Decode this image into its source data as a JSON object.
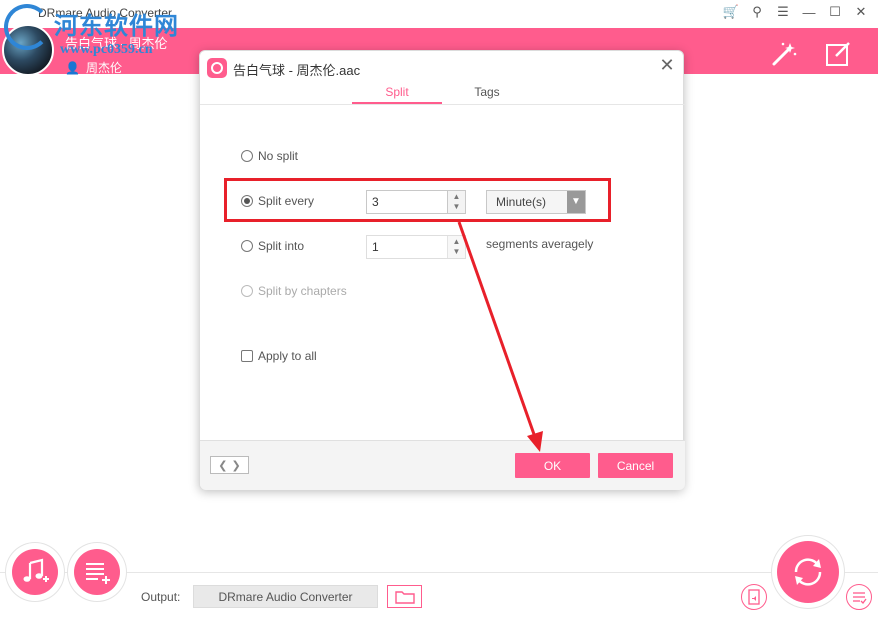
{
  "window": {
    "title": "DRmare Audio Converter",
    "controls": [
      "cart-icon",
      "search-icon",
      "menu-icon",
      "minimize-icon",
      "maximize-icon",
      "close-icon"
    ]
  },
  "watermark": {
    "main": "河东软件网",
    "url": "www.pc0359.cn"
  },
  "header": {
    "song_title": "告白气球 - 周杰伦",
    "artist": "周杰伦",
    "accent_color": "#ff5c8d"
  },
  "dialog": {
    "title": "告白气球 - 周杰伦.aac",
    "tabs": [
      {
        "label": "Split",
        "active": true
      },
      {
        "label": "Tags",
        "active": false
      }
    ],
    "options": {
      "no_split": "No split",
      "split_every": "Split every",
      "split_every_value": "3",
      "split_every_unit": "Minute(s)",
      "split_into": "Split into",
      "split_into_value": "1",
      "segments_hint": "segments averagely",
      "split_by_chapters": "Split by chapters",
      "apply_to_all": "Apply to all"
    },
    "selected_option": "split_every",
    "footer": {
      "ok": "OK",
      "cancel": "Cancel"
    }
  },
  "bottom": {
    "output_label": "Output:",
    "output_path": "DRmare Audio Converter"
  }
}
